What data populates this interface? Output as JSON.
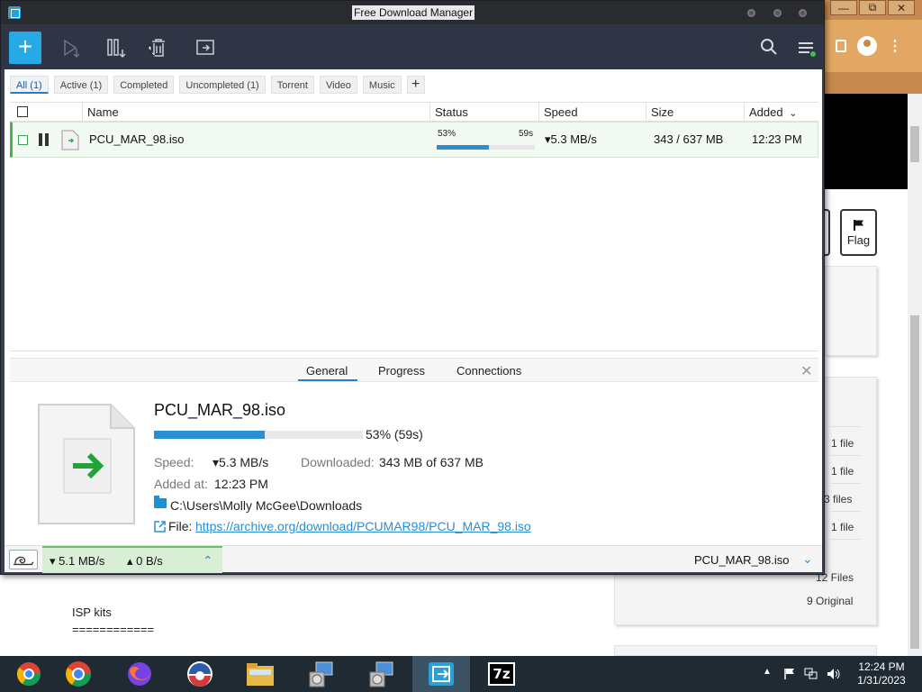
{
  "window": {
    "title": "Free Download Manager"
  },
  "filters": [
    {
      "label": "All (1)",
      "active": true
    },
    {
      "label": "Active (1)",
      "active": false
    },
    {
      "label": "Completed",
      "active": false
    },
    {
      "label": "Uncompleted (1)",
      "active": false
    },
    {
      "label": "Torrent",
      "active": false
    },
    {
      "label": "Video",
      "active": false
    },
    {
      "label": "Music",
      "active": false
    }
  ],
  "filter_add_label": "+",
  "table": {
    "columns": [
      "Name",
      "Status",
      "Speed",
      "Size",
      "Added"
    ],
    "sort_indicator": "⌄",
    "rows": [
      {
        "name": "PCU_MAR_98.iso",
        "percent_text": "53%",
        "eta": "59s",
        "progress": 0.53,
        "speed": "▾5.3 MB/s",
        "size": "343 / 637 MB",
        "added": "12:23 PM"
      }
    ]
  },
  "details": {
    "tabs": [
      "General",
      "Progress",
      "Connections"
    ],
    "active_tab": "General",
    "close_glyph": "✕",
    "filename": "PCU_MAR_98.iso",
    "progress": 0.53,
    "progress_text": "53% (59s)",
    "speed_label": "Speed:",
    "speed_value": "▾5.3 MB/s",
    "downloaded_label": "Downloaded:",
    "downloaded_value": "343 MB of 637 MB",
    "added_label": "Added at:",
    "added_value": "12:23 PM",
    "folder": "C:\\Users\\Molly McGee\\Downloads",
    "file_label": "File:",
    "url": "https://archive.org/download/PCUMAR98/PCU_MAR_98.iso"
  },
  "status_bar": {
    "download_speed": "▾ 5.1 MB/s",
    "upload_speed": "▴ 0 B/s",
    "up_chevron": "⌃",
    "current_file": "PCU_MAR_98.iso",
    "down_chevron": "⌄"
  },
  "background": {
    "window_controls": [
      "—",
      "⧉",
      "✕"
    ],
    "flag_label": "Flag",
    "counts": [
      "1 file",
      "1 file",
      "3 files",
      "1 file",
      "12 Files",
      "9 Original"
    ],
    "isp_text": "ISP kits",
    "isp_rule": "============"
  },
  "taskbar": {
    "apps": [
      "chrome-like-icon",
      "chrome-icon",
      "firefox-icon",
      "obama-logo-icon",
      "file-explorer-icon",
      "installer-icon",
      "installer-icon-2",
      "free-download-manager-icon",
      "7zip-icon"
    ],
    "seven_zip_label": "7z",
    "time": "12:24 PM",
    "date": "1/31/2023"
  },
  "colors": {
    "accent": "#27a9e5",
    "toolbar": "#2f3545",
    "progress": "#2a8fd1",
    "row_highlight": "#4caf50"
  }
}
